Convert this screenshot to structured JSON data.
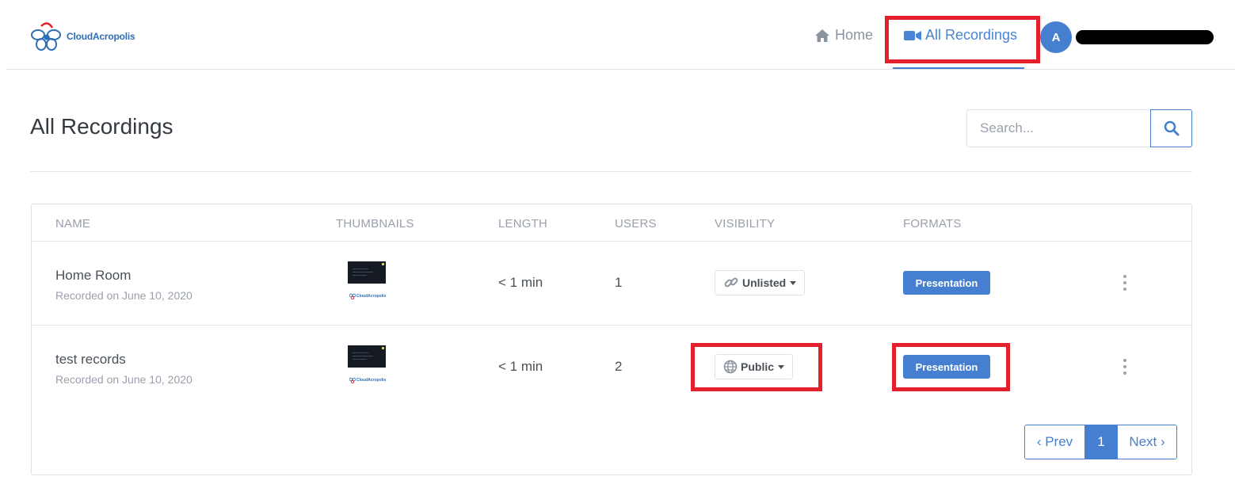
{
  "header": {
    "logo_text": "CloudAcropolis",
    "nav": {
      "home_label": "Home",
      "recordings_label": "All Recordings"
    },
    "user": {
      "avatar_initial": "A"
    }
  },
  "page": {
    "title": "All Recordings",
    "search": {
      "placeholder": "Search..."
    }
  },
  "table": {
    "columns": [
      "NAME",
      "THUMBNAILS",
      "LENGTH",
      "USERS",
      "VISIBILITY",
      "FORMATS"
    ],
    "rows": [
      {
        "name": "Home Room",
        "recorded": "Recorded on June 10, 2020",
        "length": "< 1 min",
        "users": "1",
        "visibility": "Unlisted",
        "visibility_icon": "link-icon",
        "format": "Presentation"
      },
      {
        "name": "test records",
        "recorded": "Recorded on June 10, 2020",
        "length": "< 1 min",
        "users": "2",
        "visibility": "Public",
        "visibility_icon": "globe-icon",
        "format": "Presentation"
      }
    ]
  },
  "pagination": {
    "prev_label": "‹ Prev",
    "current_page": "1",
    "next_label": "Next ›"
  },
  "colors": {
    "primary": "#467fcf",
    "highlight": "#e4202d",
    "muted": "#9aa0ac"
  }
}
